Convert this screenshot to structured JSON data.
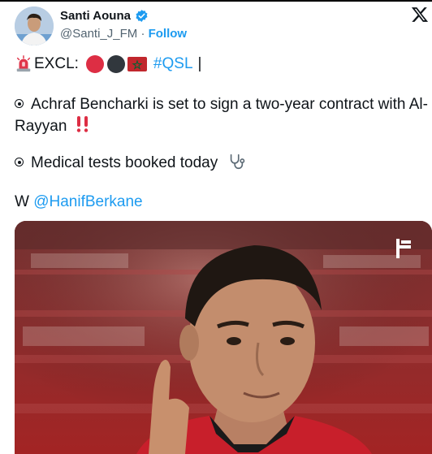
{
  "author": {
    "name": "Santi Aouna",
    "handle": "@Santi_J_FM",
    "separator": "·",
    "follow_label": "Follow",
    "verified_color": "#1d9bf0"
  },
  "tweet": {
    "line1": {
      "prefix": "EXCL:",
      "hashtag": "#QSL",
      "suffix": "|"
    },
    "point1": "Achraf Bencharki is set to sign a two-year contract with Al-Rayyan",
    "point2": "Medical tests booked today",
    "credit_prefix": "W",
    "credit_mention": "@HanifBerkane"
  },
  "icons": {
    "siren": "rotating-light-icon",
    "dots": [
      "red-circle-icon",
      "black-circle-icon",
      "morocco-flag-icon"
    ],
    "alarm": "double-exclamation-icon",
    "stethoscope": "stethoscope-icon",
    "close": "x-logo-icon",
    "media_badge": "f-logo-icon"
  },
  "colors": {
    "link": "#1d9bf0",
    "text": "#0f1419",
    "secondary": "#536471"
  }
}
